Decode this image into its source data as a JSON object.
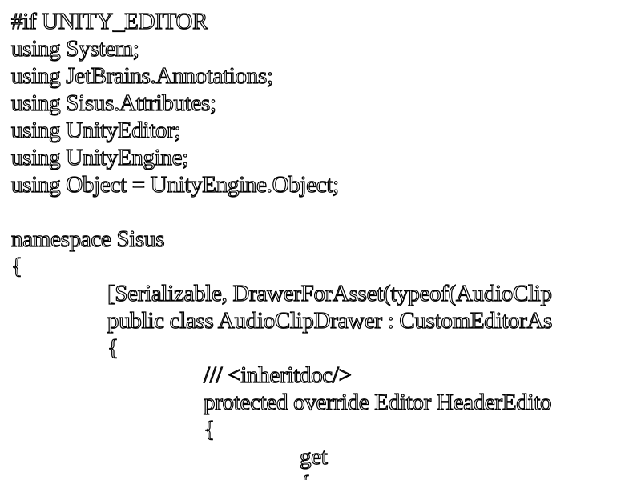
{
  "code_lines": [
    "#if UNITY_EDITOR",
    "using System;",
    "using JetBrains.Annotations;",
    "using Sisus.Attributes;",
    "using UnityEditor;",
    "using UnityEngine;",
    "using Object = UnityEngine.Object;",
    "",
    "namespace Sisus",
    "{",
    "[Serializable, DrawerForAsset(typeof(AudioClip",
    "public class AudioClipDrawer : CustomEditorAs",
    "{",
    "/// <inheritdoc/>",
    "protected override Editor HeaderEdito",
    "{",
    "get",
    "{"
  ]
}
